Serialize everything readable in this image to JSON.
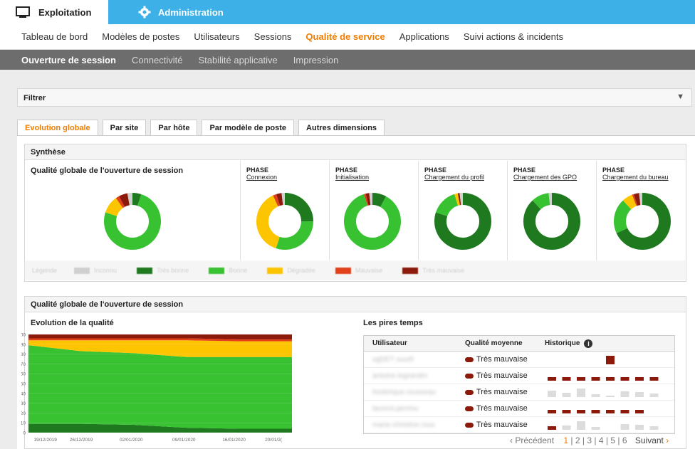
{
  "header": {
    "exploitation": "Exploitation",
    "administration": "Administration"
  },
  "nav1": [
    "Tableau de bord",
    "Modèles de postes",
    "Utilisateurs",
    "Sessions",
    "Qualité de service",
    "Applications",
    "Suivi actions & incidents"
  ],
  "nav1_active": 4,
  "nav2": [
    "Ouverture de session",
    "Connectivité",
    "Stabilité applicative",
    "Impression"
  ],
  "filter": {
    "label": "Filtrer",
    "arrow": "▼"
  },
  "tabs": [
    "Evolution globale",
    "Par site",
    "Par hôte",
    "Par modèle de poste",
    "Autres dimensions"
  ],
  "synthese": {
    "title": "Synthèse",
    "global_title": "Qualité globale de l'ouverture de session",
    "phase_label": "PHASE",
    "phases": [
      "Connexion",
      "Initialisation",
      "Chargement du profil",
      "Chargement des GPO",
      "Chargement du bureau"
    ],
    "legend": {
      "title": "Légende",
      "items": [
        "Inconnu",
        "Très bonne",
        "Bonne",
        "Dégradée",
        "Mauvaise",
        "Très mauvaise"
      ]
    }
  },
  "colors": {
    "unknown": "#d0d0d0",
    "very_good": "#1f7a1f",
    "good": "#38c232",
    "degraded": "#fdc400",
    "bad": "#e2401b",
    "very_bad": "#8b1a0a",
    "accent": "#f07d00",
    "admin_blue": "#3eb0e8"
  },
  "donuts": [
    {
      "very_good": 5,
      "good": 75,
      "degraded": 10,
      "bad": 2,
      "very_bad": 5,
      "unknown": 3
    },
    {
      "very_good": 25,
      "good": 30,
      "degraded": 38,
      "bad": 2,
      "very_bad": 3,
      "unknown": 2
    },
    {
      "very_good": 8,
      "good": 87,
      "degraded": 0,
      "bad": 1,
      "very_bad": 2,
      "unknown": 2
    },
    {
      "very_good": 80,
      "good": 15,
      "degraded": 2,
      "bad": 0,
      "very_bad": 1,
      "unknown": 2
    },
    {
      "very_good": 88,
      "good": 10,
      "degraded": 0,
      "bad": 0,
      "very_bad": 0,
      "unknown": 2
    },
    {
      "very_good": 68,
      "good": 20,
      "degraded": 6,
      "bad": 1,
      "very_bad": 3,
      "unknown": 2
    }
  ],
  "quality": {
    "title": "Qualité globale de l'ouverture de session",
    "evolution_title": "Evolution de la qualité",
    "worst_title": "Les pires temps"
  },
  "chart_data": {
    "type": "area",
    "title": "Evolution de la qualité",
    "ylim": [
      0,
      100
    ],
    "yticks": [
      0,
      10,
      20,
      30,
      40,
      50,
      60,
      70,
      80,
      90,
      100
    ],
    "x_labels": [
      "19/12/2019",
      "26/12/2019",
      "02/01/2020",
      "09/01/2020",
      "16/01/2020",
      "20/01/2("
    ],
    "x": [
      0,
      1,
      2,
      3,
      4,
      5
    ],
    "series": [
      {
        "name": "Très bonne",
        "values": [
          9,
          9,
          8,
          5,
          4,
          4
        ]
      },
      {
        "name": "Bonne",
        "values": [
          80,
          74,
          73,
          72,
          73,
          73
        ]
      },
      {
        "name": "Dégradée",
        "values": [
          5,
          11,
          13,
          17,
          16,
          16
        ]
      },
      {
        "name": "Mauvaise",
        "values": [
          2,
          2,
          2,
          2,
          2,
          2
        ]
      },
      {
        "name": "Très mauvaise",
        "values": [
          4,
          4,
          4,
          4,
          5,
          5
        ]
      }
    ]
  },
  "worst": {
    "headers": [
      "Utilisateur",
      "Qualité moyenne",
      "Historique"
    ],
    "rows": [
      {
        "user": "xgDET xuurlt",
        "quality": "Très mauvaise",
        "hist": [
          null,
          null,
          null,
          null,
          "vb",
          null,
          null,
          null
        ]
      },
      {
        "user": "antoine.legrandm",
        "quality": "Très mauvaise",
        "hist": [
          "vb",
          "vb",
          "vb",
          "vb",
          "vb",
          "vb",
          "vb",
          "vb"
        ]
      },
      {
        "user": "frederique.rousseau",
        "quality": "Très mauvaise",
        "hist": [
          "u",
          "u",
          "u",
          "u",
          "u",
          "u",
          "u",
          "u"
        ]
      },
      {
        "user": "laurent.perrinu",
        "quality": "Très mauvaise",
        "hist": [
          "vb",
          "vb",
          "vb",
          "vb",
          "vb",
          "vb",
          "vb",
          null
        ]
      },
      {
        "user": "marie-christine.roux",
        "quality": "Très mauvaise",
        "hist": [
          "vb",
          "u",
          "u",
          "u",
          null,
          "u",
          "u",
          "u"
        ]
      }
    ]
  },
  "pager": {
    "prev": "‹ Précédent",
    "pages": [
      "1",
      "2",
      "3",
      "4",
      "5",
      "6"
    ],
    "next": "Suivant",
    "next_arrow": "›"
  }
}
